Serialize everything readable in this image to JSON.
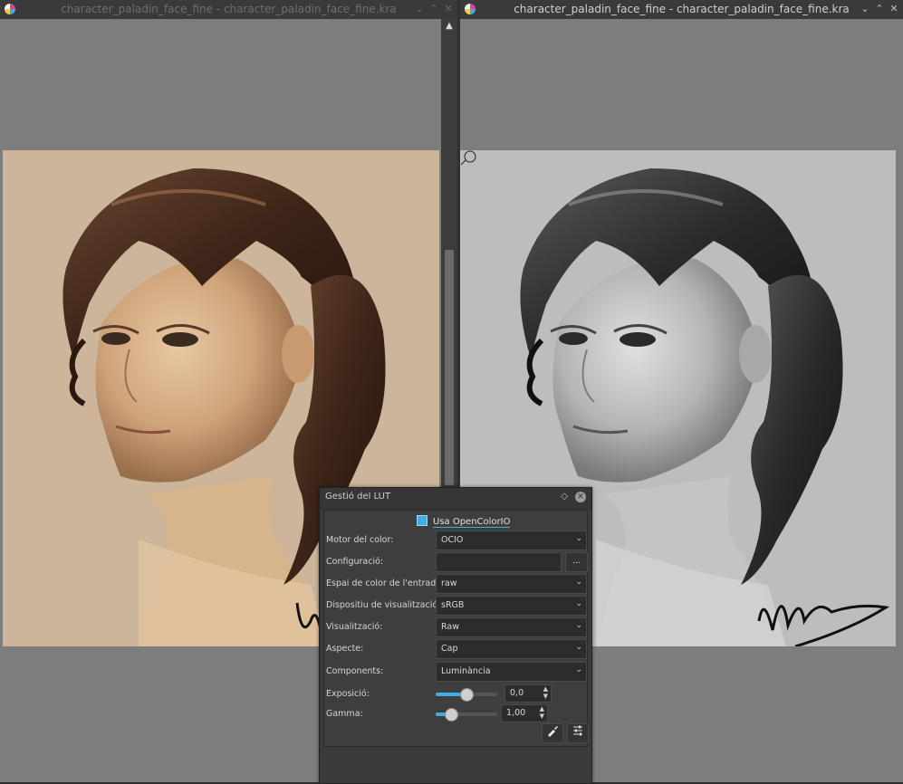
{
  "windows": {
    "left": {
      "title": "character_paladin_face_fine - character_paladin_face_fine.kra"
    },
    "right": {
      "title": "character_paladin_face_fine - character_paladin_face_fine.kra"
    }
  },
  "lut_docker": {
    "title": "Gestió del LUT",
    "use_ocio_label": "Usa OpenColorIO",
    "use_ocio_checked": true,
    "fields": {
      "color_engine": {
        "label": "Motor del color:",
        "value": "OCIO"
      },
      "configuration": {
        "label": "Configuració:",
        "value": "",
        "browse_label": "..."
      },
      "input_color_space": {
        "label": "Espai de color de l'entrada:",
        "value": "raw"
      },
      "display_device": {
        "label": "Dispositiu de visualització:",
        "value": "sRGB"
      },
      "view": {
        "label": "Visualització:",
        "value": "Raw"
      },
      "look": {
        "label": "Aspecte:",
        "value": "Cap"
      },
      "components": {
        "label": "Components:",
        "value": "Luminància"
      },
      "exposure": {
        "label": "Exposició:",
        "value": "0,0",
        "slider_fraction": 0.5
      },
      "gamma": {
        "label": "Gamma:",
        "value": "1,00",
        "slider_fraction": 0.25
      }
    }
  },
  "colors": {
    "accent": "#3daee9",
    "paper_color": "#ccb59a",
    "paper_gray": "#bdbdbd",
    "canvas_bg": "#7d7d7d"
  },
  "icons": {
    "app": "krita-icon",
    "picker": "color-picker-icon",
    "settings": "settings-sliders-icon"
  }
}
